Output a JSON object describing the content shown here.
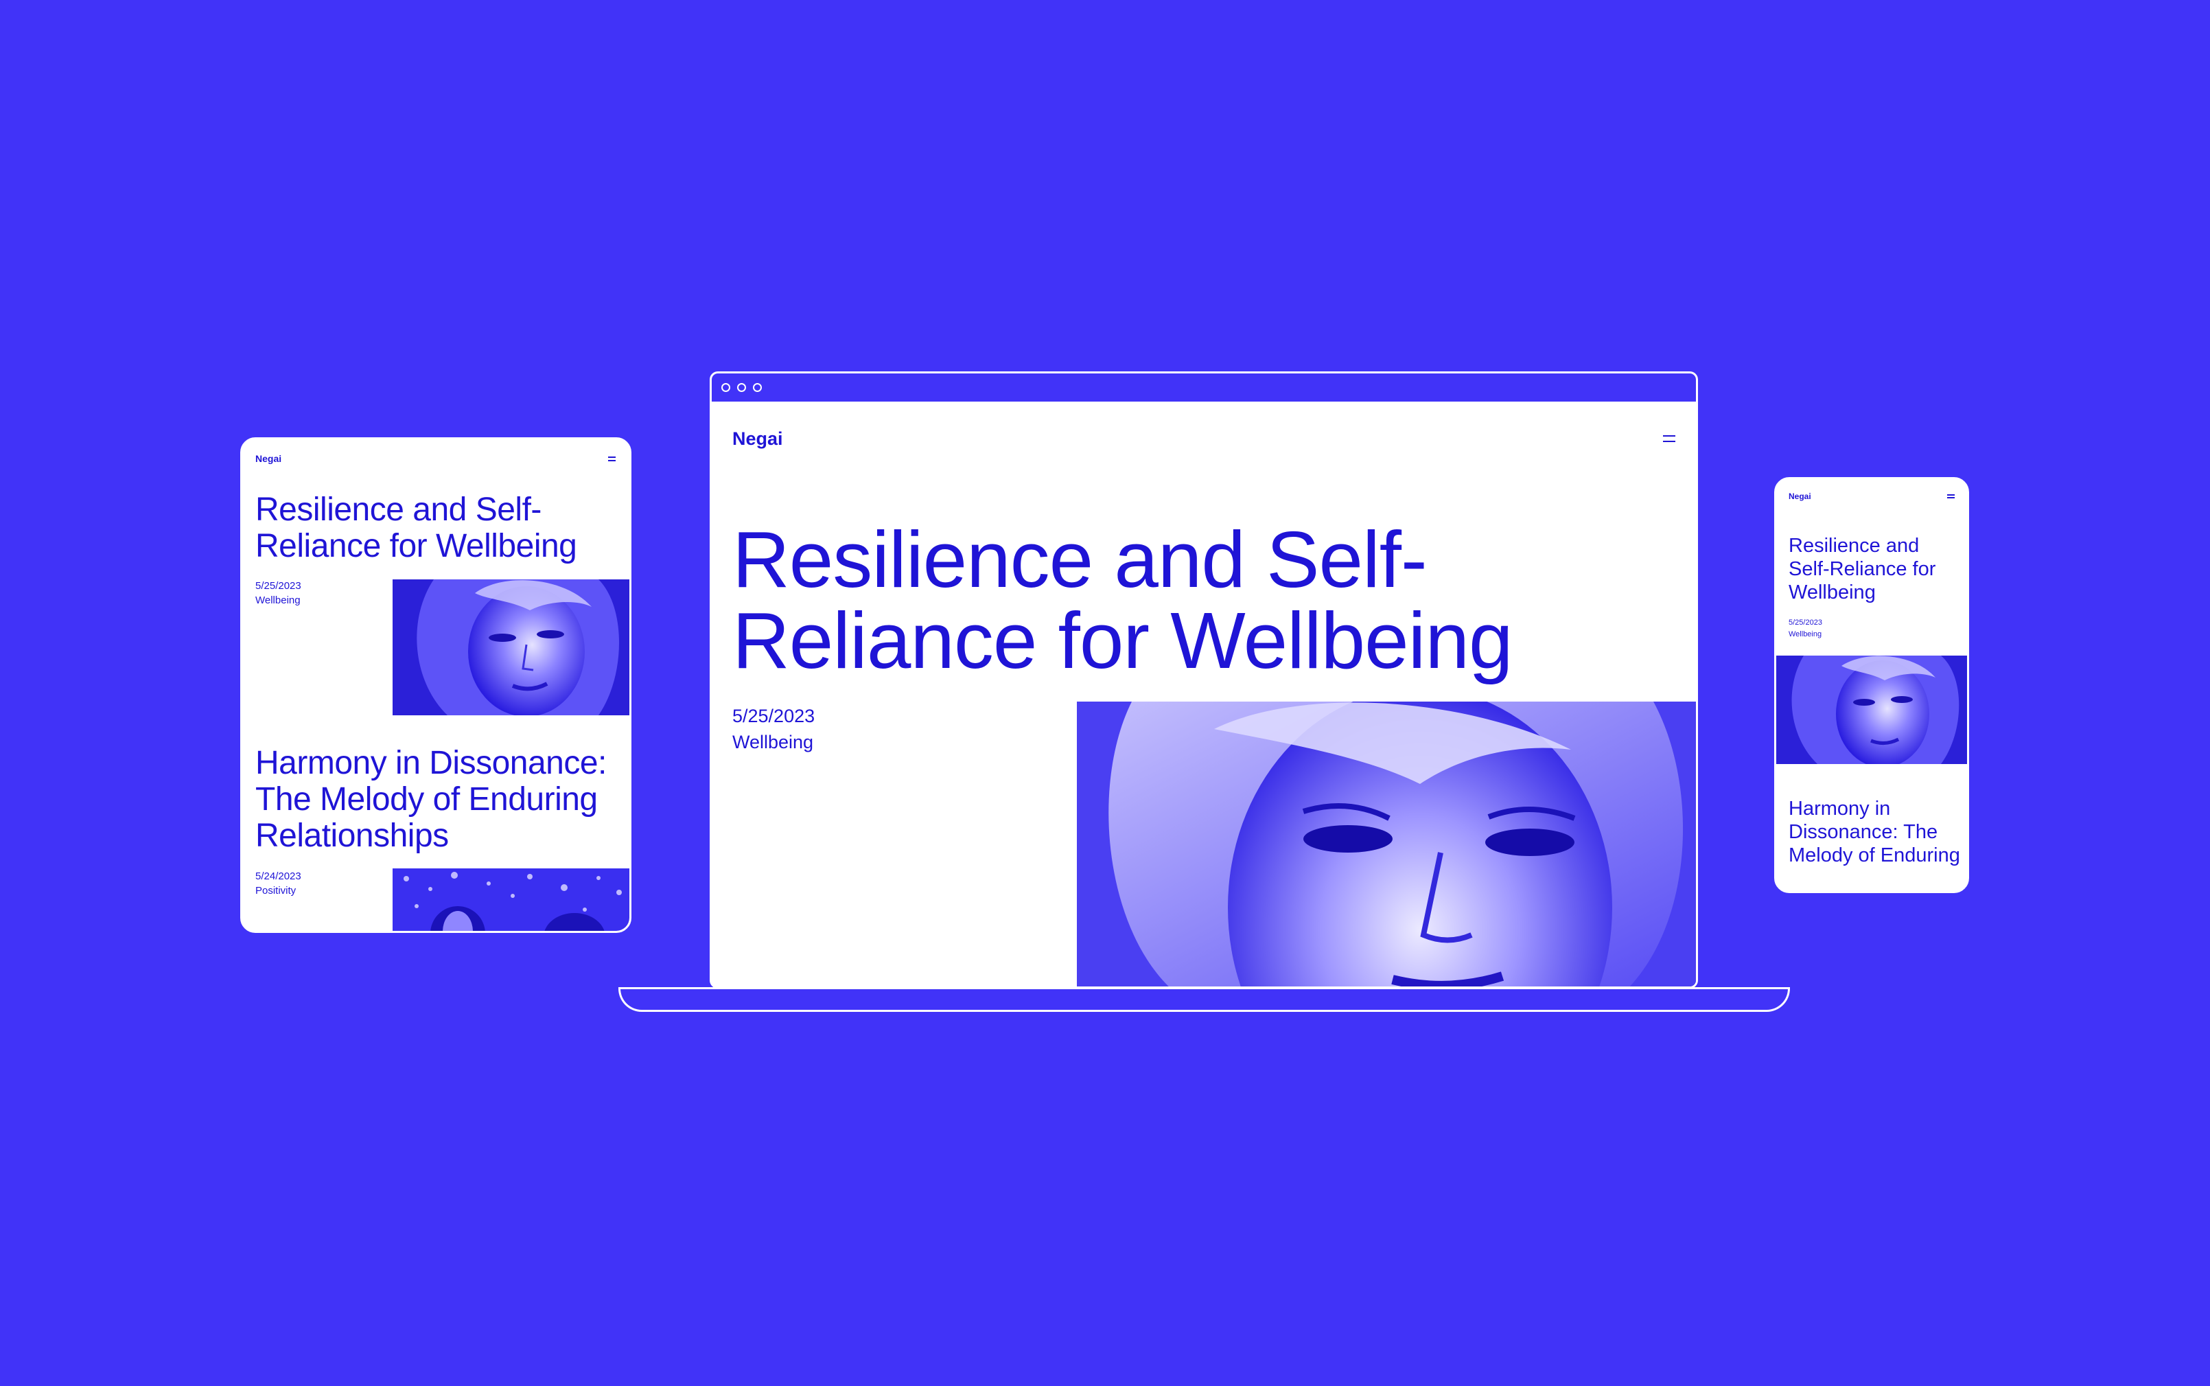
{
  "colors": {
    "background": "#4133f8",
    "site_text": "#1f14d6",
    "surface": "#ffffff"
  },
  "desktop": {
    "logo": "Negai",
    "menu_icon": "hamburger-icon",
    "article": {
      "title": "Resilience and Self-Reliance for Wellbeing",
      "date": "5/25/2023",
      "category": "Wellbeing"
    }
  },
  "tablet": {
    "logo": "Negai",
    "menu_icon": "hamburger-icon",
    "articles": [
      {
        "title": "Resilience and Self-Reliance for Wellbeing",
        "date": "5/25/2023",
        "category": "Wellbeing"
      },
      {
        "title": "Harmony in Dissonance: The Melody of Enduring Relationships",
        "date": "5/24/2023",
        "category": "Positivity"
      }
    ]
  },
  "phone": {
    "logo": "Negai",
    "menu_icon": "hamburger-icon",
    "articles": [
      {
        "title": "Resilience and Self-Reliance for Wellbeing",
        "date": "5/25/2023",
        "category": "Wellbeing"
      },
      {
        "title": "Harmony in Dissonance: The Melody of Enduring"
      }
    ]
  }
}
